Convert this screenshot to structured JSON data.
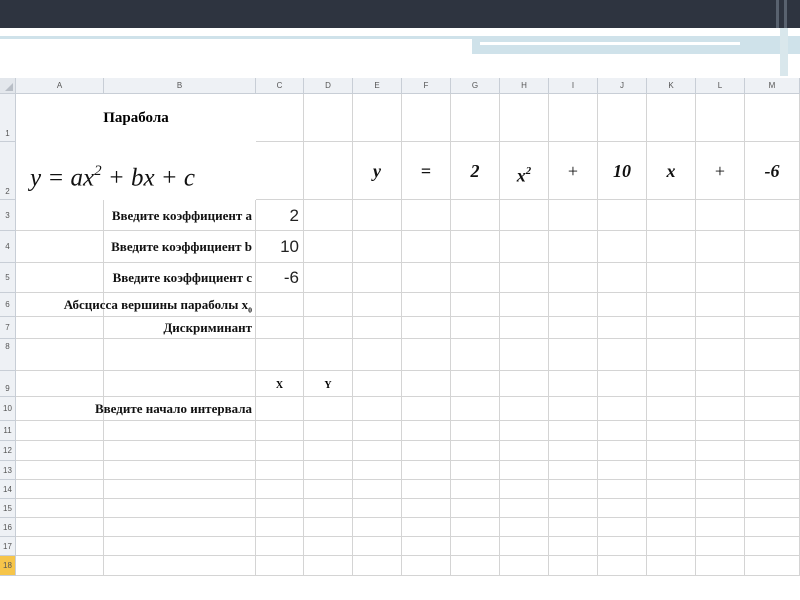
{
  "columns": [
    "A",
    "B",
    "C",
    "D",
    "E",
    "F",
    "G",
    "H",
    "I",
    "J",
    "K",
    "L",
    "M"
  ],
  "rows": [
    "1",
    "2",
    "3",
    "4",
    "5",
    "6",
    "7",
    "8",
    "9",
    "10",
    "11",
    "12",
    "13",
    "14",
    "15",
    "16",
    "17",
    "18"
  ],
  "title": "Парабола",
  "formula": {
    "y": "y",
    "equals": " = ",
    "a": "ax",
    "exp1": "2",
    "b": " + bx + c"
  },
  "labels": {
    "coef_a": "Введите коэффициент a",
    "coef_b": "Введите коэффициент b",
    "coef_c": "Введите коэффициент c",
    "vertex": "Абсцисса вершины параболы x",
    "vertex_sub": "0",
    "discriminant": "Дискриминант",
    "interval_start": "Введите начало интервала"
  },
  "values": {
    "a": "2",
    "b": "10",
    "c": "-6"
  },
  "equation_row": {
    "y": "y",
    "eq": "=",
    "a": "2",
    "x2": "x",
    "x2_exp": "2",
    "plus1": "+",
    "b": "10",
    "x": "x",
    "plus2": "+",
    "c": "-6"
  },
  "xy_headers": {
    "x": "X",
    "y": "Y"
  },
  "colors": {
    "topbar": "#2e3440",
    "accent": "#cfe2ea",
    "grid": "#d4d4d4",
    "header_bg": "#eef1f5"
  }
}
